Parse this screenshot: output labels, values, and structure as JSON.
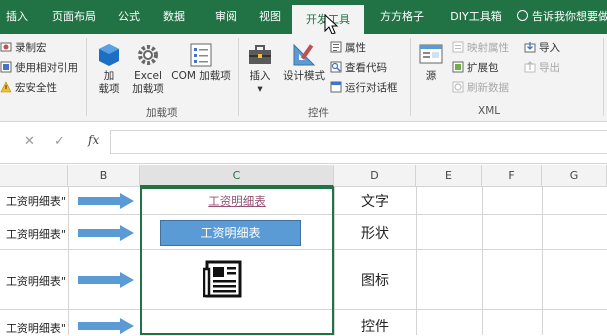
{
  "tabs": [
    {
      "label": "插入"
    },
    {
      "label": "页面布局"
    },
    {
      "label": "公式"
    },
    {
      "label": "数据"
    },
    {
      "label": "审阅"
    },
    {
      "label": "视图"
    },
    {
      "label": "开发工具",
      "active": true
    },
    {
      "label": "方方格子"
    },
    {
      "label": "DIY工具箱"
    }
  ],
  "tell_me": "告诉我你想要做什么",
  "ribbon": {
    "code": {
      "record_macro": "录制宏",
      "relative_ref": "使用相对引用",
      "macro_security": "宏安全性"
    },
    "addins": {
      "addins_label_1": "加",
      "addins_label_2": "载项",
      "excel_addins_1": "Excel",
      "excel_addins_2": "加载项",
      "com_addins": "COM 加载项",
      "group_label": "加载项"
    },
    "controls": {
      "insert": "插入",
      "design_mode": "设计模式",
      "properties": "属性",
      "view_code": "查看代码",
      "run_dialog": "运行对话框",
      "group_label": "控件"
    },
    "xml": {
      "source": "源",
      "map_properties": "映射属性",
      "expansion_packs": "扩展包",
      "refresh_data": "刷新数据",
      "import": "导入",
      "export": "导出",
      "group_label": "XML"
    }
  },
  "formula_bar": {
    "cancel": "✕",
    "enter": "✓",
    "fx": "fx",
    "value": ""
  },
  "columns": [
    "B",
    "C",
    "D",
    "E",
    "F",
    "G"
  ],
  "rows": [
    {
      "a": "工资明细表\"",
      "d": "文字"
    },
    {
      "a": "工资明细表\"",
      "d": "形状"
    },
    {
      "a": "工资明细表\"",
      "d": "图标"
    },
    {
      "a": "工资明细表\"",
      "d": "控件"
    }
  ],
  "cells": {
    "hyperlink_text": "工资明细表",
    "shape_text": "工资明细表",
    "icon": "newspaper-icon"
  },
  "colors": {
    "accent": "#217346",
    "shape_fill": "#5b9bd5",
    "arrow": "#5b9bd5",
    "hyperlink": "#954f72"
  }
}
